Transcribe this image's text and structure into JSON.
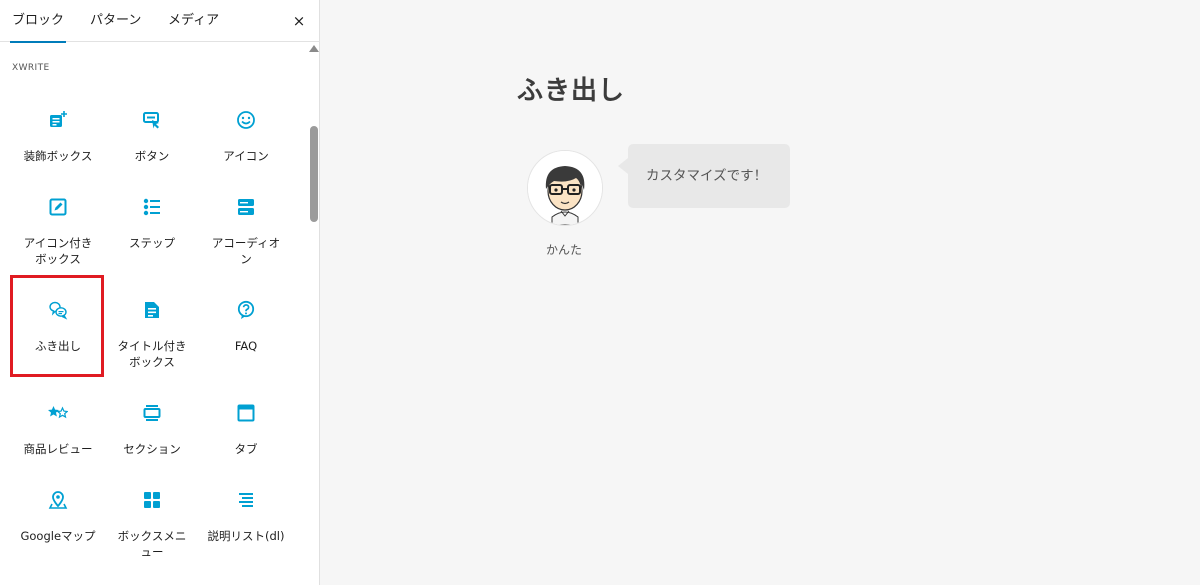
{
  "inserter": {
    "tabs": [
      {
        "label": "ブロック",
        "active": true
      },
      {
        "label": "パターン",
        "active": false
      },
      {
        "label": "メディア",
        "active": false
      }
    ],
    "close_icon": "×",
    "section_title": "XWRITE",
    "accent_color": "#00a0d2",
    "highlight_color": "#e01b22",
    "blocks": [
      {
        "label": "装飾ボックス",
        "icon": "decor-box-icon"
      },
      {
        "label": "ボタン",
        "icon": "button-pointer-icon"
      },
      {
        "label": "アイコン",
        "icon": "smiley-icon"
      },
      {
        "label": "アイコン付き\nボックス",
        "icon": "icon-box-icon"
      },
      {
        "label": "ステップ",
        "icon": "steps-list-icon"
      },
      {
        "label": "アコーディオ\nン",
        "icon": "accordion-icon"
      },
      {
        "label": "ふき出し",
        "icon": "speech-bubble-icon"
      },
      {
        "label": "タイトル付き\nボックス",
        "icon": "titled-box-icon"
      },
      {
        "label": "FAQ",
        "icon": "faq-question-icon"
      },
      {
        "label": "商品レビュー",
        "icon": "star-rating-icon"
      },
      {
        "label": "セクション",
        "icon": "section-icon"
      },
      {
        "label": "タブ",
        "icon": "tab-icon"
      },
      {
        "label": "Googleマップ",
        "icon": "map-pin-icon"
      },
      {
        "label": "ボックスメニ\nュー",
        "icon": "grid-menu-icon"
      },
      {
        "label": "説明リスト(dl)",
        "icon": "description-list-icon"
      }
    ]
  },
  "editor": {
    "title": "ふき出し",
    "balloon": {
      "speaker_name": "かんた",
      "text": "カスタマイズです！",
      "avatar_icon": "avatar-glasses-man-icon"
    }
  }
}
